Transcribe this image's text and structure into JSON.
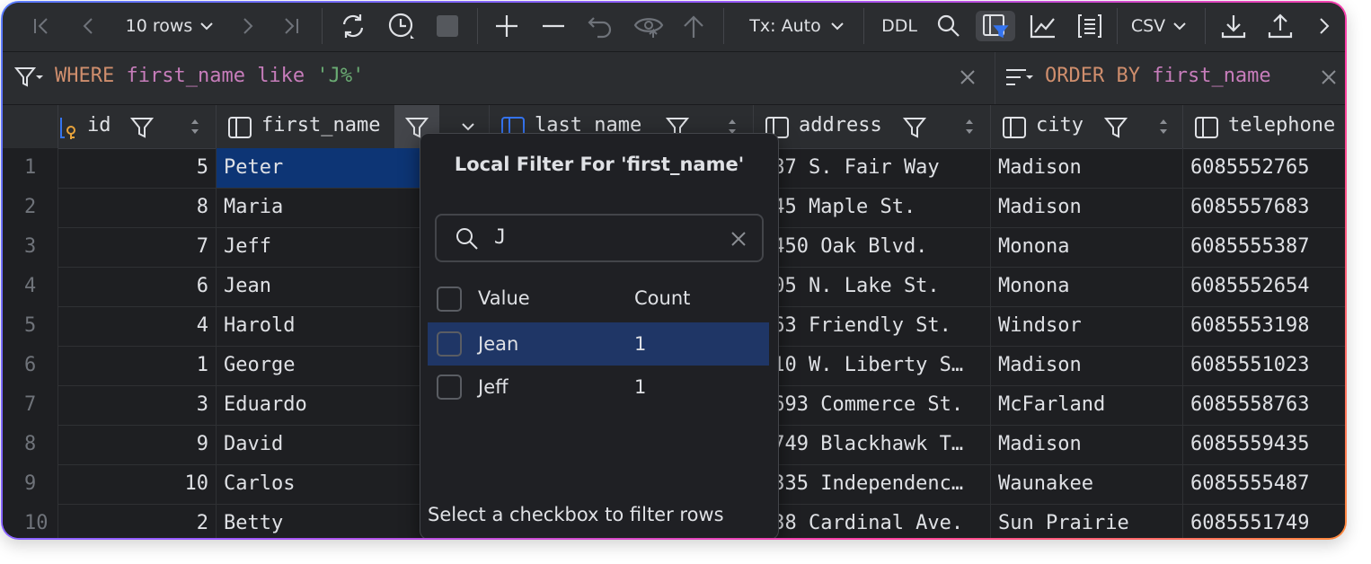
{
  "toolbar": {
    "rows_label": "10 rows",
    "tx_label": "Tx: Auto",
    "ddl_label": "DDL",
    "export_format": "CSV"
  },
  "filter": {
    "where_kw": "WHERE",
    "where_col": "first_name",
    "where_op": "like",
    "where_val": "'J%'",
    "order_kw": "ORDER BY",
    "order_col": "first_name"
  },
  "columns": [
    "id",
    "first_name",
    "last_name",
    "address",
    "city",
    "telephone"
  ],
  "rows": [
    {
      "n": "1",
      "id": "5",
      "first_name": "Peter",
      "address": "387 S. Fair Way",
      "city": "Madison",
      "telephone": "6085552765"
    },
    {
      "n": "2",
      "id": "8",
      "first_name": "Maria",
      "address": "345 Maple St.",
      "city": "Madison",
      "telephone": "6085557683"
    },
    {
      "n": "3",
      "id": "7",
      "first_name": "Jeff",
      "address": "2450 Oak Blvd.",
      "city": "Monona",
      "telephone": "6085555387"
    },
    {
      "n": "4",
      "id": "6",
      "first_name": "Jean",
      "address": "105 N. Lake St.",
      "city": "Monona",
      "telephone": "6085552654"
    },
    {
      "n": "5",
      "id": "4",
      "first_name": "Harold",
      "address": "563 Friendly St.",
      "city": "Windsor",
      "telephone": "6085553198"
    },
    {
      "n": "6",
      "id": "1",
      "first_name": "George",
      "address": "110 W. Liberty S…",
      "city": "Madison",
      "telephone": "6085551023"
    },
    {
      "n": "7",
      "id": "3",
      "first_name": "Eduardo",
      "address": "2693 Commerce St.",
      "city": "McFarland",
      "telephone": "6085558763"
    },
    {
      "n": "8",
      "id": "9",
      "first_name": "David",
      "address": "2749 Blackhawk T…",
      "city": "Madison",
      "telephone": "6085559435"
    },
    {
      "n": "9",
      "id": "10",
      "first_name": "Carlos",
      "address": "2335 Independenc…",
      "city": "Waunakee",
      "telephone": "6085555487"
    },
    {
      "n": "10",
      "id": "2",
      "first_name": "Betty",
      "address": "638 Cardinal Ave.",
      "city": "Sun Prairie",
      "telephone": "6085551749"
    }
  ],
  "popup": {
    "title": "Local Filter For 'first_name'",
    "search_value": "J",
    "col_value": "Value",
    "col_count": "Count",
    "items": [
      {
        "value": "Jean",
        "count": "1"
      },
      {
        "value": "Jeff",
        "count": "1"
      }
    ],
    "footer": "Select a checkbox to filter rows"
  },
  "colors": {
    "accent": "#3574f0",
    "selection": "#0d3575",
    "popup_selected_row": "#1f3666"
  }
}
